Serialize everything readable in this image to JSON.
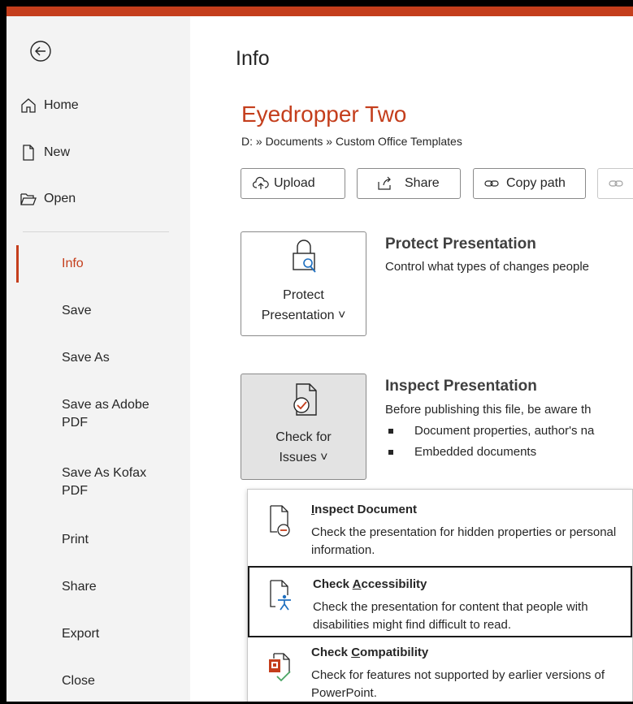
{
  "sidebar": {
    "back_label": "Back",
    "items": [
      {
        "label": "Home"
      },
      {
        "label": "New"
      },
      {
        "label": "Open"
      }
    ],
    "sub_items": [
      {
        "label": "Info"
      },
      {
        "label": "Save"
      },
      {
        "label": "Save As"
      },
      {
        "label": "Save as Adobe PDF"
      },
      {
        "label": "Save As Kofax PDF"
      },
      {
        "label": "Print"
      },
      {
        "label": "Share"
      },
      {
        "label": "Export"
      },
      {
        "label": "Close"
      }
    ]
  },
  "main": {
    "page_title": "Info",
    "doc_title": "Eyedropper Two",
    "breadcrumb": "D: » Documents » Custom Office Templates",
    "buttons": {
      "upload": "Upload",
      "share": "Share",
      "copy_path": "Copy path"
    },
    "protect": {
      "button_line1": "Protect",
      "button_line2": "Presentation ˅",
      "title": "Protect Presentation",
      "desc": "Control what types of changes people"
    },
    "inspect": {
      "button_line1": "Check for",
      "button_line2": "Issues ˅",
      "title": "Inspect Presentation",
      "desc": "Before publishing this file, be aware th",
      "bullets": [
        "Document properties, author's na",
        "Embedded documents"
      ]
    }
  },
  "dropdown": {
    "items": [
      {
        "title_pre": "",
        "title_accel": "I",
        "title_post": "nspect Document",
        "desc": "Check the presentation for hidden properties or personal information."
      },
      {
        "title_pre": "Check ",
        "title_accel": "A",
        "title_post": "ccessibility",
        "desc": "Check the presentation for content that people with disabilities might find difficult to read."
      },
      {
        "title_pre": "Check ",
        "title_accel": "C",
        "title_post": "ompatibility",
        "desc": "Check for features not supported by earlier versions of PowerPoint."
      }
    ]
  },
  "colors": {
    "accent": "#c43e1c",
    "sidebar_bg": "#f3f3f3"
  }
}
